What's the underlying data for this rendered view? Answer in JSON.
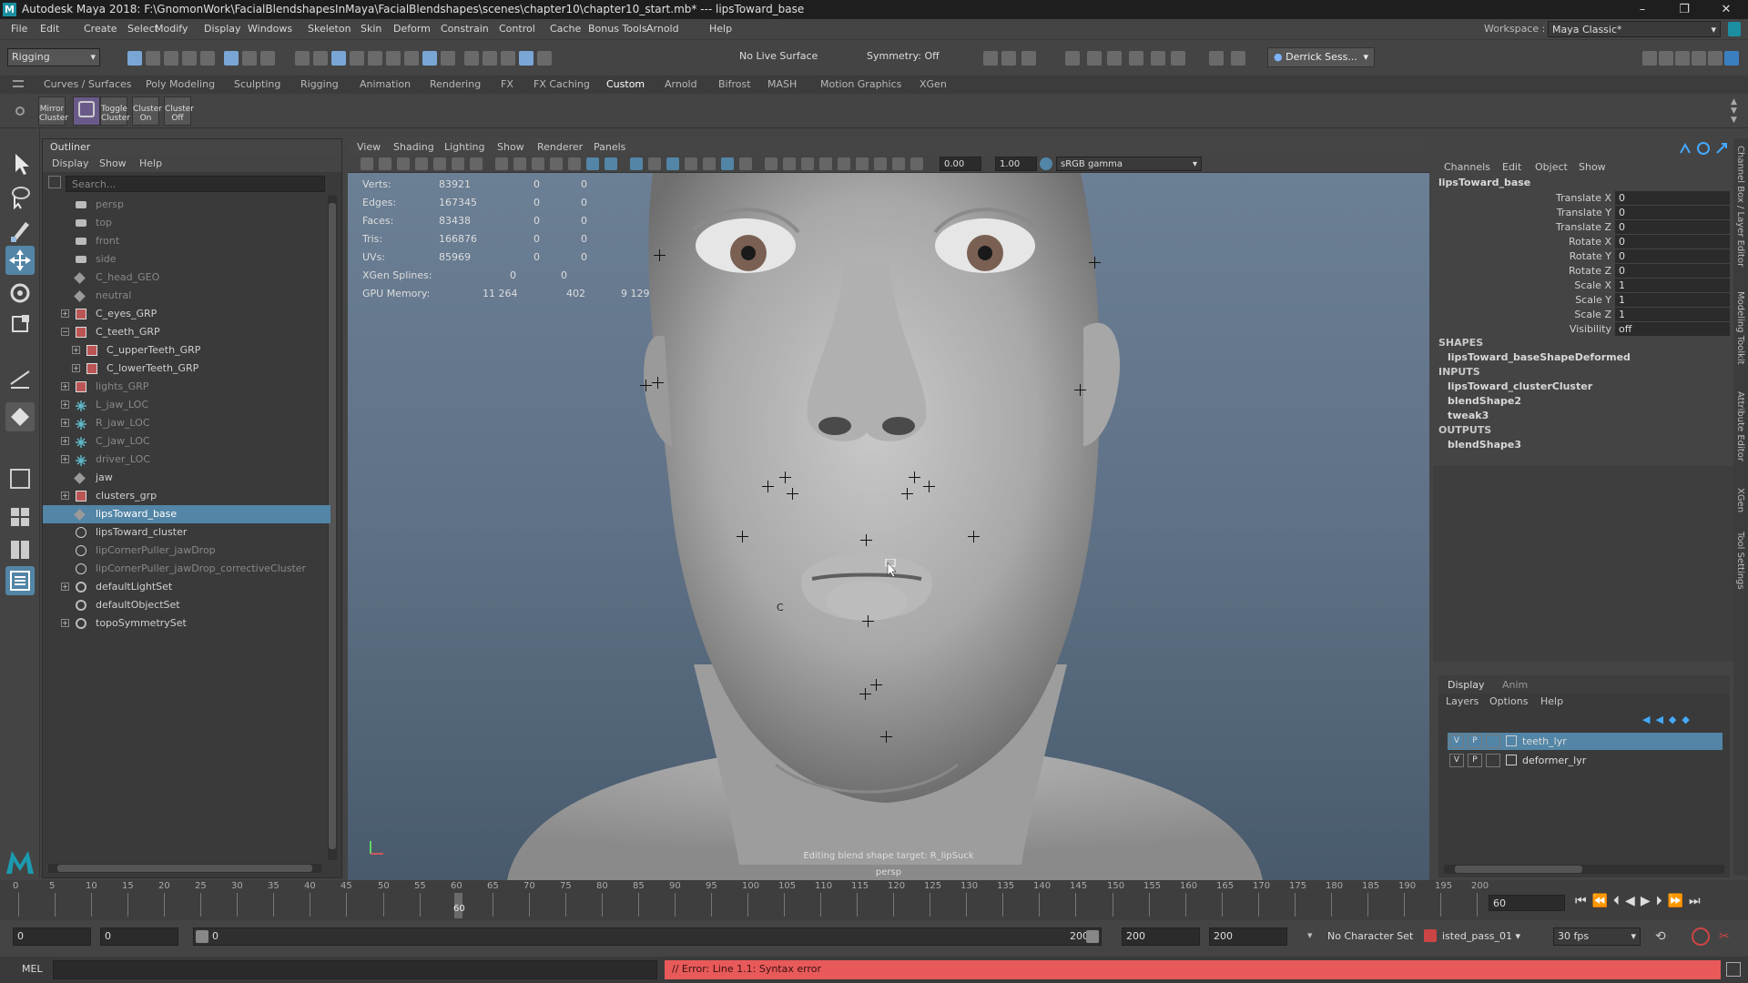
{
  "app": {
    "title": "Autodesk Maya 2018: F:\\GnomonWork\\FacialBlendshapesInMaya\\FacialBlendshapes\\scenes\\chapter10\\chapter10_start.mb*  ---  lipsToward_base",
    "logo": "M",
    "window_buttons": [
      "–",
      "❐",
      "✕"
    ]
  },
  "menubar": {
    "items": [
      "File",
      "Edit",
      "Create",
      "Select",
      "Modify",
      "Display",
      "Windows",
      "Skeleton",
      "Skin",
      "Deform",
      "Constrain",
      "Control",
      "Cache",
      "Bonus Tools",
      "Arnold",
      "Help"
    ],
    "workspace_label": "Workspace :",
    "workspace_value": "Maya Classic*"
  },
  "statusline": {
    "mode": "Rigging",
    "live_surface": "No Live Surface",
    "symmetry": "Symmetry: Off",
    "user": "Derrick Sess..."
  },
  "shelf": {
    "tabs": [
      "Curves / Surfaces",
      "Poly Modeling",
      "Sculpting",
      "Rigging",
      "Animation",
      "Rendering",
      "FX",
      "FX Caching",
      "Custom",
      "Arnold",
      "Bifrost",
      "MASH",
      "Motion Graphics",
      "XGen"
    ],
    "active_tab": "Custom",
    "buttons": [
      {
        "label": "Mirror\nCluster"
      },
      {
        "label": ""
      },
      {
        "label": "Toggle\nCluster"
      },
      {
        "label": "Cluster\nOn"
      },
      {
        "label": "Cluster\nOff"
      }
    ]
  },
  "outliner": {
    "title": "Outliner",
    "menu": [
      "Display",
      "Show",
      "Help"
    ],
    "search_placeholder": "Search...",
    "rows": [
      {
        "label": "persp",
        "icon": "camera-icon",
        "dim": true,
        "indent": 1,
        "exp": false
      },
      {
        "label": "top",
        "icon": "camera-icon",
        "dim": true,
        "indent": 1,
        "exp": false
      },
      {
        "label": "front",
        "icon": "camera-icon",
        "dim": true,
        "indent": 1,
        "exp": false
      },
      {
        "label": "side",
        "icon": "camera-icon",
        "dim": true,
        "indent": 1,
        "exp": false
      },
      {
        "label": "C_head_GEO",
        "icon": "mesh-icon",
        "dim": true,
        "indent": 1,
        "exp": false
      },
      {
        "label": "neutral",
        "icon": "mesh-icon",
        "dim": true,
        "indent": 1,
        "exp": false
      },
      {
        "label": "C_eyes_GRP",
        "icon": "group-icon",
        "dim": false,
        "indent": 1,
        "exp": "+"
      },
      {
        "label": "C_teeth_GRP",
        "icon": "group-icon",
        "dim": false,
        "indent": 1,
        "exp": "−"
      },
      {
        "label": "C_upperTeeth_GRP",
        "icon": "group-icon",
        "dim": false,
        "indent": 2,
        "exp": "+"
      },
      {
        "label": "C_lowerTeeth_GRP",
        "icon": "group-icon",
        "dim": false,
        "indent": 2,
        "exp": "+"
      },
      {
        "label": "lights_GRP",
        "icon": "group-icon",
        "dim": true,
        "indent": 1,
        "exp": "+"
      },
      {
        "label": "L_jaw_LOC",
        "icon": "locator-icon",
        "dim": true,
        "indent": 1,
        "exp": "+"
      },
      {
        "label": "R_jaw_LOC",
        "icon": "locator-icon",
        "dim": true,
        "indent": 1,
        "exp": "+"
      },
      {
        "label": "C_jaw_LOC",
        "icon": "locator-icon",
        "dim": true,
        "indent": 1,
        "exp": "+"
      },
      {
        "label": "driver_LOC",
        "icon": "locator-icon",
        "dim": true,
        "indent": 1,
        "exp": "+"
      },
      {
        "label": "jaw",
        "icon": "mesh-icon",
        "dim": false,
        "indent": 1,
        "exp": false
      },
      {
        "label": "clusters_grp",
        "icon": "group-icon",
        "dim": false,
        "indent": 1,
        "exp": "+"
      },
      {
        "label": "lipsToward_base",
        "icon": "mesh-icon",
        "dim": false,
        "indent": 1,
        "exp": false,
        "selected": true
      },
      {
        "label": "lipsToward_cluster",
        "icon": "deformer-icon",
        "dim": false,
        "indent": 1,
        "exp": false
      },
      {
        "label": "lipCornerPuller_jawDrop",
        "icon": "deformer-icon",
        "dim": true,
        "indent": 1,
        "exp": false
      },
      {
        "label": "lipCornerPuller_jawDrop_correctiveCluster",
        "icon": "deformer-icon",
        "dim": true,
        "indent": 1,
        "exp": false
      },
      {
        "label": "defaultLightSet",
        "icon": "set-icon",
        "dim": false,
        "indent": 1,
        "exp": "+"
      },
      {
        "label": "defaultObjectSet",
        "icon": "set-icon",
        "dim": false,
        "indent": 1,
        "exp": false
      },
      {
        "label": "topoSymmetrySet",
        "icon": "set-icon",
        "dim": false,
        "indent": 1,
        "exp": "+"
      }
    ]
  },
  "viewport": {
    "menu": [
      "View",
      "Shading",
      "Lighting",
      "Show",
      "Renderer",
      "Panels"
    ],
    "exposure": "0.00",
    "gamma": "1.00",
    "colorspace": "sRGB gamma",
    "hud": [
      {
        "label": "Verts:",
        "a": "83921",
        "b": "0",
        "c": "0"
      },
      {
        "label": "Edges:",
        "a": "167345",
        "b": "0",
        "c": "0"
      },
      {
        "label": "Faces:",
        "a": "83438",
        "b": "0",
        "c": "0"
      },
      {
        "label": "Tris:",
        "a": "166876",
        "b": "0",
        "c": "0"
      },
      {
        "label": "UVs:",
        "a": "85969",
        "b": "0",
        "c": "0"
      }
    ],
    "hud_xgen": {
      "label": "XGen Splines:",
      "a": "0",
      "b": "0"
    },
    "hud_gpu": {
      "label": "GPU Memory:",
      "a": "11 264",
      "b": "402",
      "c": "9 129"
    },
    "editing_msg": "Editing blend shape target: R_lipSuck",
    "camera": "persp",
    "cluster_label": "C"
  },
  "channelbox": {
    "menu": [
      "Channels",
      "Edit",
      "Object",
      "Show"
    ],
    "node": "lipsToward_base",
    "attrs": [
      {
        "name": "Translate X",
        "value": "0"
      },
      {
        "name": "Translate Y",
        "value": "0"
      },
      {
        "name": "Translate Z",
        "value": "0"
      },
      {
        "name": "Rotate X",
        "value": "0"
      },
      {
        "name": "Rotate Y",
        "value": "0"
      },
      {
        "name": "Rotate Z",
        "value": "0"
      },
      {
        "name": "Scale X",
        "value": "1"
      },
      {
        "name": "Scale Y",
        "value": "1"
      },
      {
        "name": "Scale Z",
        "value": "1"
      },
      {
        "name": "Visibility",
        "value": "off"
      }
    ],
    "shapes_label": "SHAPES",
    "shapes": [
      "lipsToward_baseShapeDeformed"
    ],
    "inputs_label": "INPUTS",
    "inputs": [
      "lipsToward_clusterCluster",
      "blendShape2",
      "tweak3"
    ],
    "outputs_label": "OUTPUTS",
    "outputs": [
      "blendShape3"
    ]
  },
  "layers": {
    "tabs": [
      "Display",
      "Anim"
    ],
    "menu": [
      "Layers",
      "Options",
      "Help"
    ],
    "items": [
      {
        "name": "teeth_lyr",
        "v": "V",
        "p": "P",
        "selected": true
      },
      {
        "name": "deformer_lyr",
        "v": "V",
        "p": "P",
        "selected": false
      }
    ]
  },
  "right_strip": [
    "Channel Box / Layer Editor",
    "Modeling Toolkit",
    "Attribute Editor",
    "XGen",
    "Tool Settings"
  ],
  "timeline": {
    "ticks": [
      "0",
      "5",
      "10",
      "15",
      "20",
      "25",
      "30",
      "35",
      "40",
      "45",
      "50",
      "55",
      "60",
      "65",
      "70",
      "75",
      "80",
      "85",
      "90",
      "95",
      "100",
      "105",
      "110",
      "115",
      "120",
      "125",
      "130",
      "135",
      "140",
      "145",
      "150",
      "155",
      "160",
      "165",
      "170",
      "175",
      "180",
      "185",
      "190",
      "195",
      "200"
    ],
    "current_frame_marker": "60",
    "current_frame": "60",
    "current_frame_fraction": 0.3
  },
  "range": {
    "start": "0",
    "playback_start": "0",
    "slider_start": "0",
    "slider_end": "200",
    "playback_end": "200",
    "end": "200",
    "character_set": "No Character Set",
    "anim_layer": "isted_pass_01",
    "fps": "30 fps"
  },
  "cmdline": {
    "lang": "MEL",
    "error": "// Error: Line 1.1: Syntax error"
  },
  "colors": {
    "selection": "#5285a6",
    "error_bg": "#e85a5a",
    "accent": "#1b8fa1"
  }
}
